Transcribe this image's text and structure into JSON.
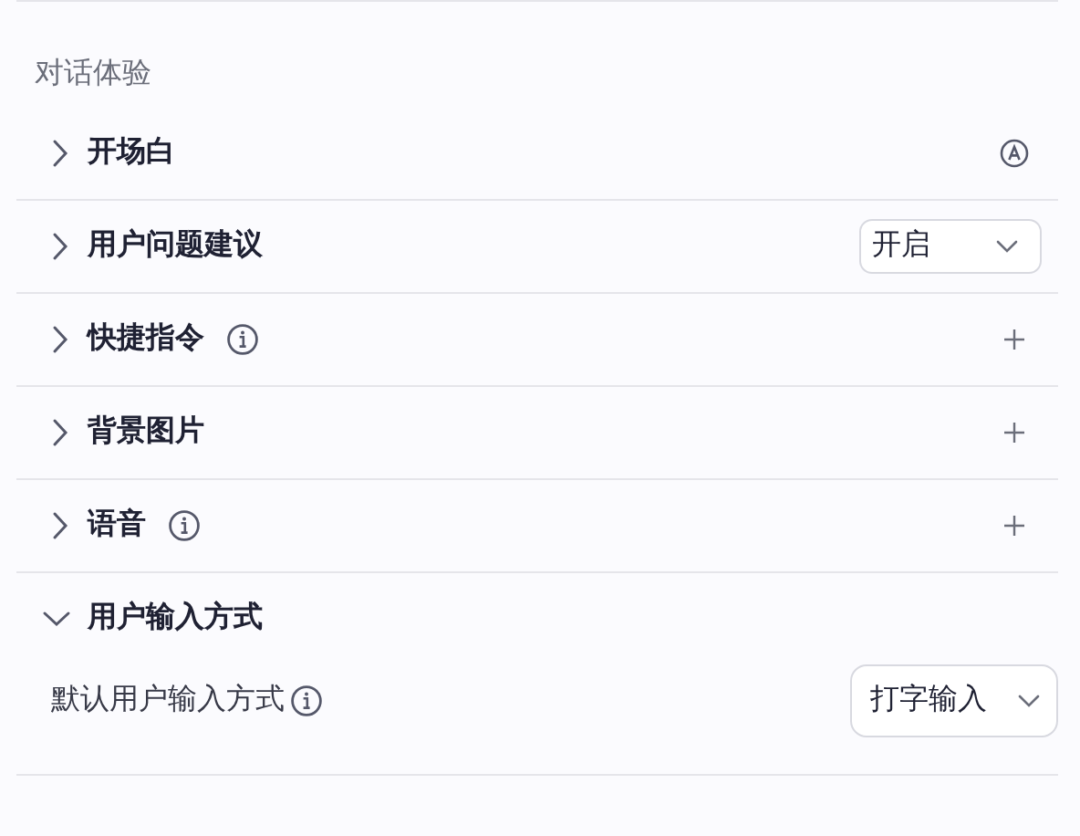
{
  "section_title": "对话体验",
  "items": [
    {
      "title": "开场白",
      "expanded": false,
      "info": false,
      "kind": "auto"
    },
    {
      "title": "用户问题建议",
      "expanded": false,
      "info": false,
      "kind": "select",
      "value": "开启"
    },
    {
      "title": "快捷指令",
      "expanded": false,
      "info": true,
      "kind": "add"
    },
    {
      "title": "背景图片",
      "expanded": false,
      "info": false,
      "kind": "add"
    },
    {
      "title": "语音",
      "expanded": false,
      "info": true,
      "kind": "add"
    },
    {
      "title": "用户输入方式",
      "expanded": true,
      "info": false,
      "kind": "none",
      "settings": [
        {
          "label": "默认用户输入方式",
          "info": true,
          "value": "打字输入"
        }
      ]
    }
  ]
}
